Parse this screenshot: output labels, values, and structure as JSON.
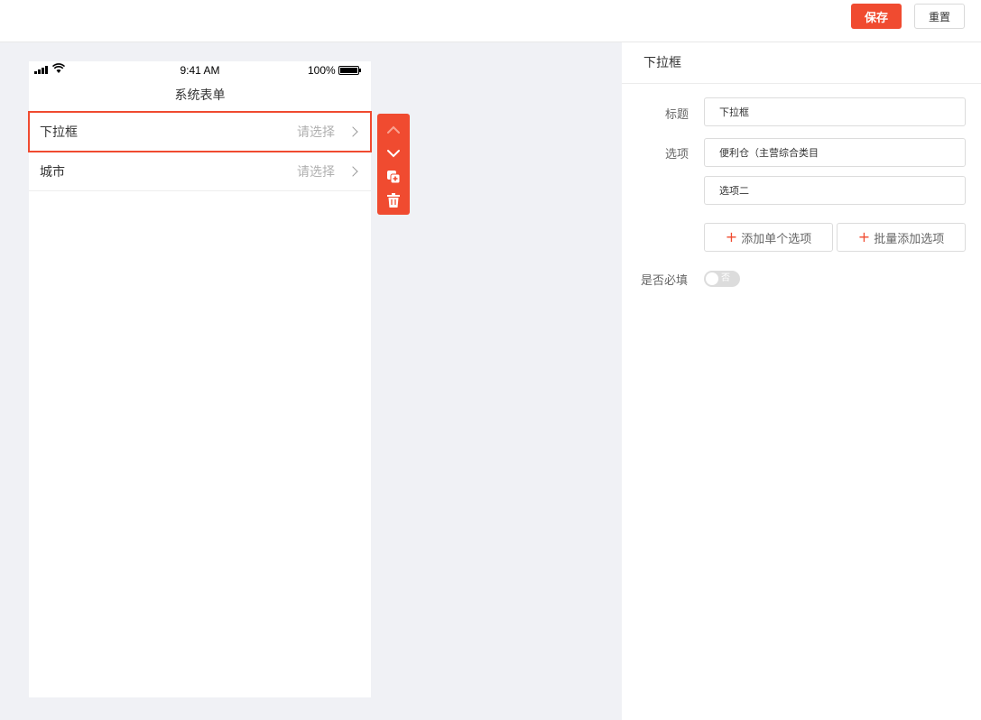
{
  "header": {
    "save_label": "保存",
    "reset_label": "重置"
  },
  "phone": {
    "status": {
      "time": "9:41 AM",
      "battery": "100%"
    },
    "title": "系统表单",
    "rows": [
      {
        "label": "下拉框",
        "placeholder": "请选择"
      },
      {
        "label": "城市",
        "placeholder": "请选择"
      }
    ]
  },
  "panel": {
    "heading": "下拉框",
    "title_label": "标题",
    "title_value": "下拉框",
    "options_label": "选项",
    "options": [
      "便利仓（主营综合类目",
      "选项二"
    ],
    "add_single_label": "添加单个选项",
    "add_batch_label": "批量添加选项",
    "required_label": "是否必填",
    "required_toggle_text": "否"
  },
  "colors": {
    "accent": "#f04b30",
    "canvas_bg": "#f0f1f5"
  }
}
